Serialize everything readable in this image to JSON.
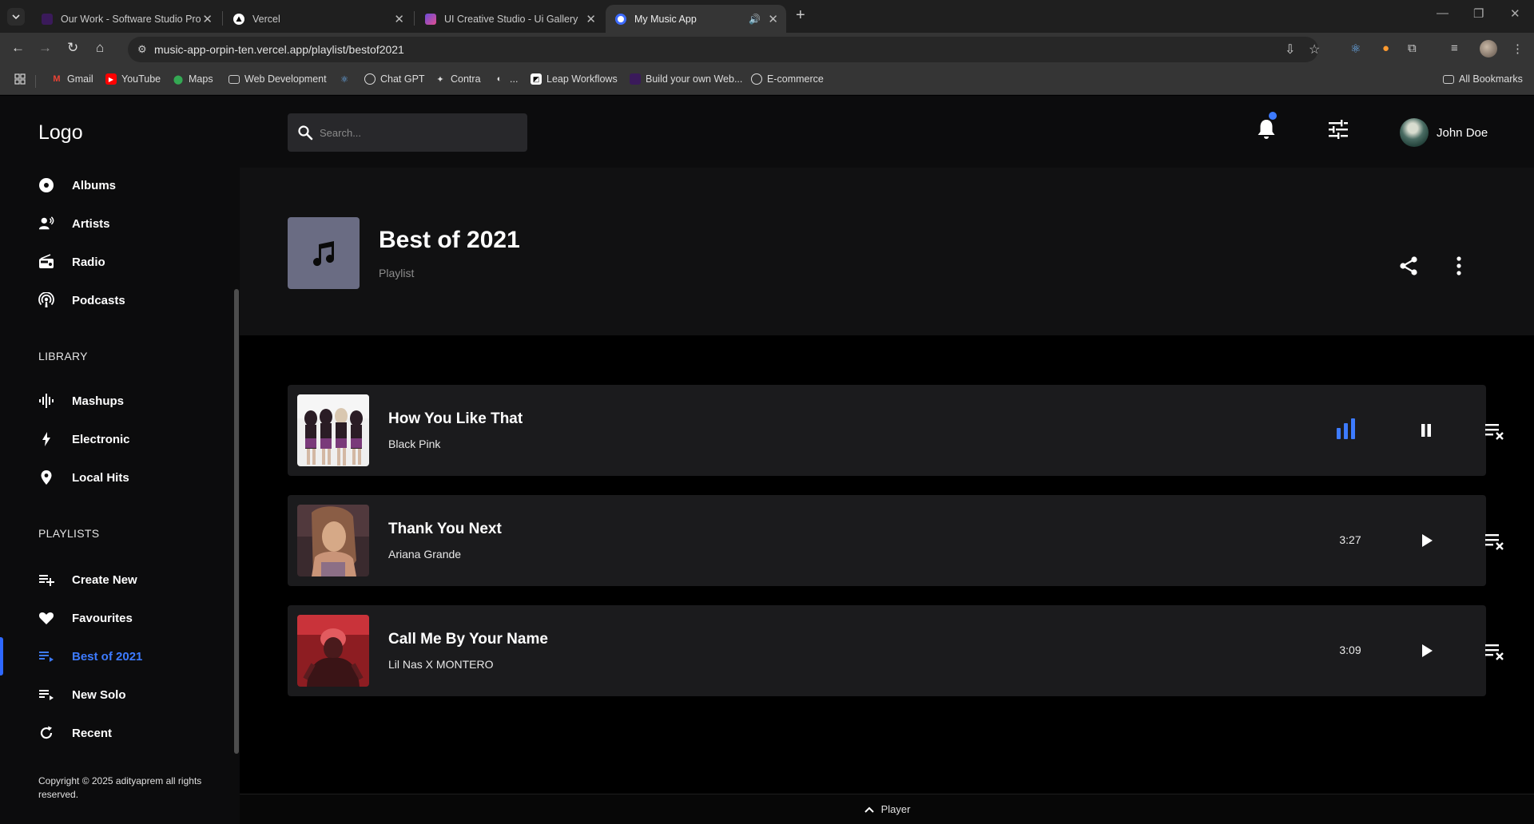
{
  "browser": {
    "tabs": [
      {
        "title": "Our Work - Software Studio Pro",
        "favicon_color": "#3a1a5a"
      },
      {
        "title": "Vercel",
        "favicon_color": "#ffffff"
      },
      {
        "title": "UI Creative Studio - Ui Gallery",
        "favicon_color": "#4b3aa8"
      },
      {
        "title": "My Music App",
        "favicon_color": "#3d6bff"
      }
    ],
    "url": "music-app-orpin-ten.vercel.app/playlist/bestof2021",
    "bookmarks": [
      {
        "label": "Gmail",
        "icon": "gmail-icon"
      },
      {
        "label": "YouTube",
        "icon": "youtube-icon"
      },
      {
        "label": "Maps",
        "icon": "maps-icon"
      },
      {
        "label": "Web Development",
        "icon": "folder-icon"
      },
      {
        "label": "",
        "icon": "react-icon"
      },
      {
        "label": "Chat GPT",
        "icon": "chatgpt-icon"
      },
      {
        "label": "Contra",
        "icon": "contra-icon"
      },
      {
        "label": "...",
        "icon": "globe-icon"
      },
      {
        "label": "Leap Workflows",
        "icon": "leap-icon"
      },
      {
        "label": "Build your own Web...",
        "icon": "build-icon"
      },
      {
        "label": "E-commerce",
        "icon": "ecommerce-icon"
      }
    ],
    "all_bookmarks": "All Bookmarks"
  },
  "sidebar": {
    "logo": "Logo",
    "browse": [
      {
        "label": "Albums",
        "icon": "album-icon"
      },
      {
        "label": "Artists",
        "icon": "artist-icon"
      },
      {
        "label": "Radio",
        "icon": "radio-icon"
      },
      {
        "label": "Podcasts",
        "icon": "podcast-icon"
      }
    ],
    "library_heading": "LIBRARY",
    "library": [
      {
        "label": "Mashups",
        "icon": "waveform-icon"
      },
      {
        "label": "Electronic",
        "icon": "bolt-icon"
      },
      {
        "label": "Local Hits",
        "icon": "location-pin-icon"
      }
    ],
    "playlists_heading": "PLAYLISTS",
    "playlists": [
      {
        "label": "Create New",
        "icon": "playlist-add-icon"
      },
      {
        "label": "Favourites",
        "icon": "heart-icon"
      },
      {
        "label": "Best of 2021",
        "icon": "playlist-icon",
        "active": true
      },
      {
        "label": "New Solo",
        "icon": "playlist-icon"
      },
      {
        "label": "Recent",
        "icon": "refresh-icon"
      }
    ],
    "copyright": "Copyright © 2025 adityaprem all rights reserved.",
    "accent_color": "#3d7bff"
  },
  "topbar": {
    "search_placeholder": "Search...",
    "user_name": "John Doe"
  },
  "playlist": {
    "title": "Best of 2021",
    "type": "Playlist",
    "tracks": [
      {
        "title": "How You Like That",
        "artist": "Black Pink",
        "duration": "",
        "state": "playing"
      },
      {
        "title": "Thank You Next",
        "artist": "Ariana Grande",
        "duration": "3:27",
        "state": "paused"
      },
      {
        "title": "Call Me By Your Name",
        "artist": "Lil Nas X MONTERO",
        "duration": "3:09",
        "state": "paused"
      }
    ]
  },
  "player": {
    "label": "Player"
  }
}
